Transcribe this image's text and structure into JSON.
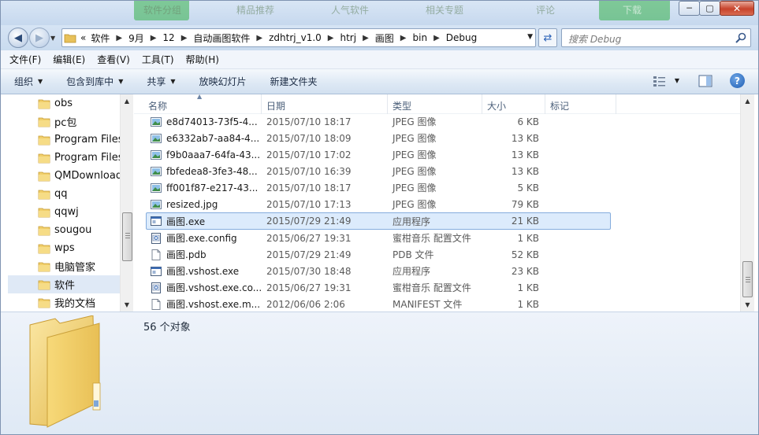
{
  "window": {
    "background_tabs": [
      "软件分组",
      "精品推荐",
      "人气软件",
      "相关专题",
      "评论",
      "下载"
    ],
    "minimize_glyph": "─",
    "maximize_glyph": "▢",
    "close_glyph": "✕"
  },
  "address": {
    "overflow": "«",
    "crumbs": [
      "软件",
      "9月",
      "12",
      "自动画图软件",
      "zdhtrj_v1.0",
      "htrj",
      "画图",
      "bin",
      "Debug"
    ]
  },
  "search": {
    "placeholder": "搜索 Debug"
  },
  "menu": [
    "文件(F)",
    "编辑(E)",
    "查看(V)",
    "工具(T)",
    "帮助(H)"
  ],
  "toolbar": {
    "organize": "组织",
    "include_in_library": "包含到库中",
    "share": "共享",
    "slideshow": "放映幻灯片",
    "new_folder": "新建文件夹",
    "help": "?"
  },
  "nav": {
    "items": [
      {
        "label": "obs"
      },
      {
        "label": "pc包"
      },
      {
        "label": "Program Files"
      },
      {
        "label": "Program Files"
      },
      {
        "label": "QMDownload"
      },
      {
        "label": "qq"
      },
      {
        "label": "qqwj"
      },
      {
        "label": "sougou"
      },
      {
        "label": "wps"
      },
      {
        "label": "电脑管家"
      },
      {
        "label": "软件",
        "selected": true
      },
      {
        "label": "我的文档"
      }
    ]
  },
  "columns": {
    "name": "名称",
    "date": "日期",
    "type": "类型",
    "size": "大小",
    "tags": "标记"
  },
  "files": [
    {
      "name": "e8d74013-73f5-4...",
      "date": "2015/07/10 18:17",
      "type": "JPEG 图像",
      "size": "6 KB",
      "icon": "image-file-icon"
    },
    {
      "name": "e6332ab7-aa84-4...",
      "date": "2015/07/10 18:09",
      "type": "JPEG 图像",
      "size": "13 KB",
      "icon": "image-file-icon"
    },
    {
      "name": "f9b0aaa7-64fa-43...",
      "date": "2015/07/10 17:02",
      "type": "JPEG 图像",
      "size": "13 KB",
      "icon": "image-file-icon"
    },
    {
      "name": "fbfedea8-3fe3-48...",
      "date": "2015/07/10 16:39",
      "type": "JPEG 图像",
      "size": "13 KB",
      "icon": "image-file-icon"
    },
    {
      "name": "ff001f87-e217-43...",
      "date": "2015/07/10 18:17",
      "type": "JPEG 图像",
      "size": "5 KB",
      "icon": "image-file-icon"
    },
    {
      "name": "resized.jpg",
      "date": "2015/07/10 17:13",
      "type": "JPEG 图像",
      "size": "79 KB",
      "icon": "image-file-icon"
    },
    {
      "name": "画图.exe",
      "date": "2015/07/29 21:49",
      "type": "应用程序",
      "size": "21 KB",
      "icon": "exe-file-icon",
      "selected": true
    },
    {
      "name": "画图.exe.config",
      "date": "2015/06/27 19:31",
      "type": "蜜柑音乐 配置文件",
      "size": "1 KB",
      "icon": "config-file-icon"
    },
    {
      "name": "画图.pdb",
      "date": "2015/07/29 21:49",
      "type": "PDB 文件",
      "size": "52 KB",
      "icon": "blank-file-icon"
    },
    {
      "name": "画图.vshost.exe",
      "date": "2015/07/30 18:48",
      "type": "应用程序",
      "size": "23 KB",
      "icon": "exe-file-icon"
    },
    {
      "name": "画图.vshost.exe.co...",
      "date": "2015/06/27 19:31",
      "type": "蜜柑音乐 配置文件",
      "size": "1 KB",
      "icon": "config-file-icon"
    },
    {
      "name": "画图.vshost.exe.m...",
      "date": "2012/06/06 2:06",
      "type": "MANIFEST 文件",
      "size": "1 KB",
      "icon": "blank-file-icon"
    }
  ],
  "details": {
    "object_count": "56 个对象"
  },
  "colors": {
    "selection": "#dcebfc",
    "selection_border": "#84acdd",
    "chrome": "#d6e4f4"
  }
}
